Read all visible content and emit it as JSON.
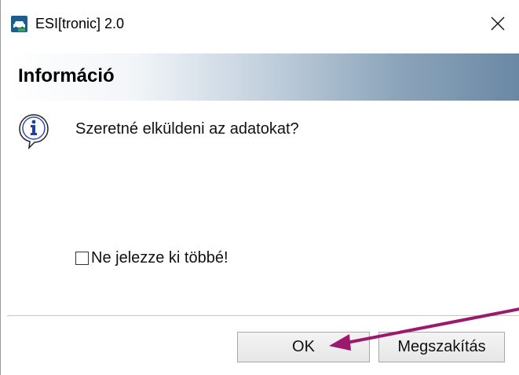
{
  "window": {
    "title": "ESI[tronic] 2.0",
    "app_icon": "car-diagnostic-icon",
    "close_glyph": "✕"
  },
  "header": {
    "title": "Információ"
  },
  "message": {
    "icon": "info-icon",
    "text": "Szeretné elküldeni az adatokat?"
  },
  "checkbox": {
    "label": "Ne jelezze ki többé!",
    "checked": false
  },
  "buttons": {
    "ok_label": "OK",
    "cancel_label": "Megszakítás"
  },
  "annotation": {
    "icon": "arrow-pointer",
    "color": "#9b1a6e"
  },
  "colors": {
    "header_gradient_end": "#6a88a4"
  }
}
